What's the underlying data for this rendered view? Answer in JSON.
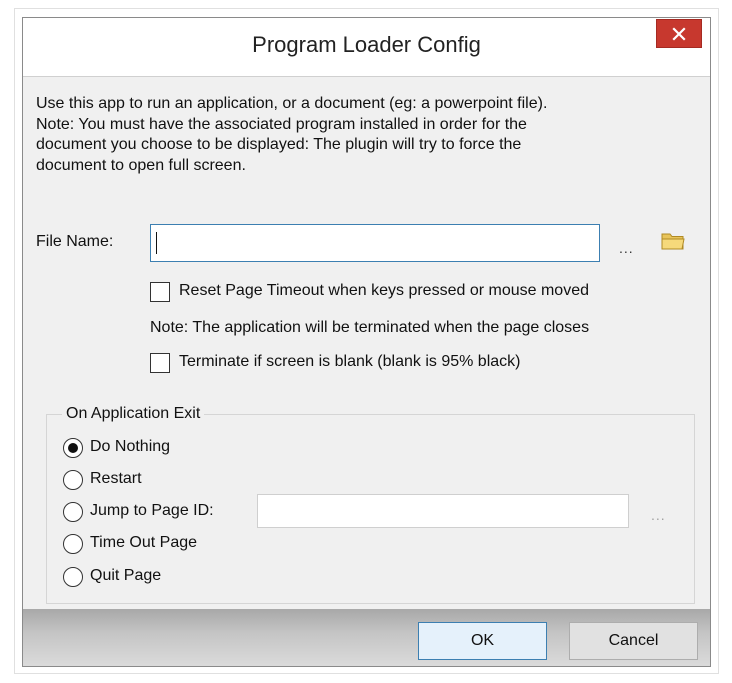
{
  "window": {
    "title": "Program Loader Config"
  },
  "description": {
    "lines": [
      "Use this app to run an application, or a document (eg: a powerpoint file).",
      "Note: You must have the associated program installed in order for the",
      "document you choose to be displayed:  The plugin will try to force the",
      "document to open full screen."
    ]
  },
  "file": {
    "label": "File Name:",
    "value": "",
    "browse_label": "...",
    "folder_icon": "folder-icon"
  },
  "options": {
    "reset_timeout_label": "Reset Page Timeout when keys pressed or mouse moved",
    "reset_timeout_checked": false,
    "note": "Note: The application will be terminated when the page closes",
    "terminate_blank_label": "Terminate if screen is blank  (blank is 95% black)",
    "terminate_blank_checked": false
  },
  "on_exit": {
    "group_title": "On Application Exit",
    "options": [
      {
        "label": "Do Nothing",
        "selected": true
      },
      {
        "label": "Restart",
        "selected": false
      },
      {
        "label": "Jump to Page ID:",
        "selected": false
      },
      {
        "label": "Time Out Page",
        "selected": false
      },
      {
        "label": "Quit Page",
        "selected": false
      }
    ],
    "page_id_value": "",
    "page_id_browse_label": "..."
  },
  "buttons": {
    "ok_label": "OK",
    "cancel_label": "Cancel"
  },
  "colors": {
    "close_button": "#c7382e",
    "focus_border": "#3c7fb1"
  }
}
